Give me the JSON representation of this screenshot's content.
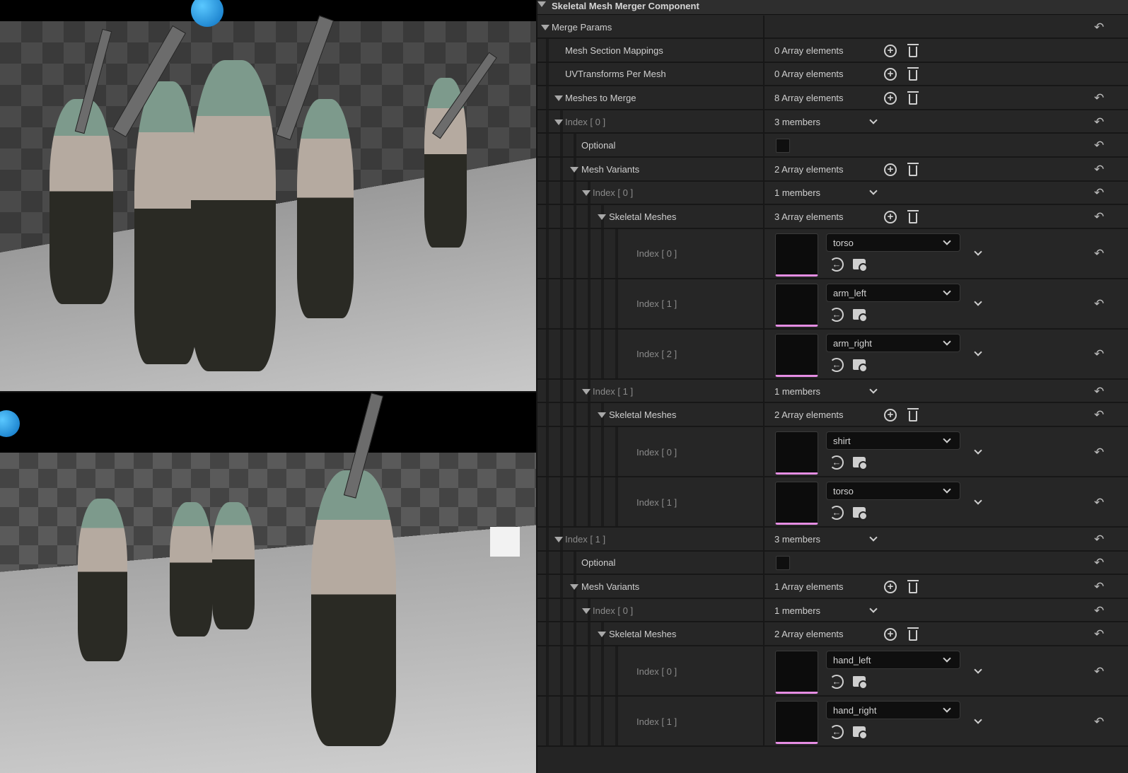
{
  "panel": {
    "title": "Skeletal Mesh Merger Component",
    "rows": [
      {
        "kind": "group",
        "depth": 0,
        "label": "Merge Params",
        "expanded": true,
        "reset": true
      },
      {
        "kind": "array",
        "depth": 1,
        "label": "Mesh Section Mappings",
        "value": "0 Array elements",
        "reset": false
      },
      {
        "kind": "array",
        "depth": 1,
        "label": "UVTransforms Per Mesh",
        "value": "0 Array elements",
        "reset": false
      },
      {
        "kind": "array",
        "depth": 1,
        "label": "Meshes to Merge",
        "value": "8 Array elements",
        "expanded": true,
        "reset": true
      },
      {
        "kind": "struct",
        "depth": 2,
        "label": "Index [ 0 ]",
        "value": "3 members",
        "expanded": true,
        "reset": true
      },
      {
        "kind": "bool",
        "depth": 3,
        "label": "Optional",
        "checked": false,
        "reset": true
      },
      {
        "kind": "array",
        "depth": 3,
        "label": "Mesh Variants",
        "value": "2 Array elements",
        "expanded": true,
        "reset": true
      },
      {
        "kind": "struct",
        "depth": 4,
        "label": "Index [ 0 ]",
        "value": "1 members",
        "expanded": true,
        "reset": true
      },
      {
        "kind": "array",
        "depth": 5,
        "label": "Skeletal Meshes",
        "value": "3 Array elements",
        "expanded": true,
        "reset": true
      },
      {
        "kind": "asset",
        "depth": 6,
        "label": "Index [ 0 ]",
        "value": "torso",
        "reset": true
      },
      {
        "kind": "asset",
        "depth": 6,
        "label": "Index [ 1 ]",
        "value": "arm_left",
        "reset": true
      },
      {
        "kind": "asset",
        "depth": 6,
        "label": "Index [ 2 ]",
        "value": "arm_right",
        "reset": true
      },
      {
        "kind": "struct",
        "depth": 4,
        "label": "Index [ 1 ]",
        "value": "1 members",
        "expanded": true,
        "reset": true
      },
      {
        "kind": "array",
        "depth": 5,
        "label": "Skeletal Meshes",
        "value": "2 Array elements",
        "expanded": true,
        "reset": true
      },
      {
        "kind": "asset",
        "depth": 6,
        "label": "Index [ 0 ]",
        "value": "shirt",
        "reset": true
      },
      {
        "kind": "asset",
        "depth": 6,
        "label": "Index [ 1 ]",
        "value": "torso",
        "reset": true
      },
      {
        "kind": "struct",
        "depth": 2,
        "label": "Index [ 1 ]",
        "value": "3 members",
        "expanded": true,
        "reset": true
      },
      {
        "kind": "bool",
        "depth": 3,
        "label": "Optional",
        "checked": false,
        "reset": true
      },
      {
        "kind": "array",
        "depth": 3,
        "label": "Mesh Variants",
        "value": "1 Array elements",
        "expanded": true,
        "reset": true
      },
      {
        "kind": "struct",
        "depth": 4,
        "label": "Index [ 0 ]",
        "value": "1 members",
        "expanded": true,
        "reset": true
      },
      {
        "kind": "array",
        "depth": 5,
        "label": "Skeletal Meshes",
        "value": "2 Array elements",
        "expanded": true,
        "reset": true
      },
      {
        "kind": "asset",
        "depth": 6,
        "label": "Index [ 0 ]",
        "value": "hand_left",
        "reset": true
      },
      {
        "kind": "asset",
        "depth": 6,
        "label": "Index [ 1 ]",
        "value": "hand_right",
        "reset": true
      }
    ]
  },
  "icons": {
    "add": "plus-circle-icon",
    "remove": "trash-icon",
    "reset": "reset-arrow-icon",
    "use": "use-selected-icon",
    "browse": "browse-folder-icon"
  },
  "colors": {
    "panel_bg": "#242424",
    "thumb_accent": "#e58de3"
  }
}
